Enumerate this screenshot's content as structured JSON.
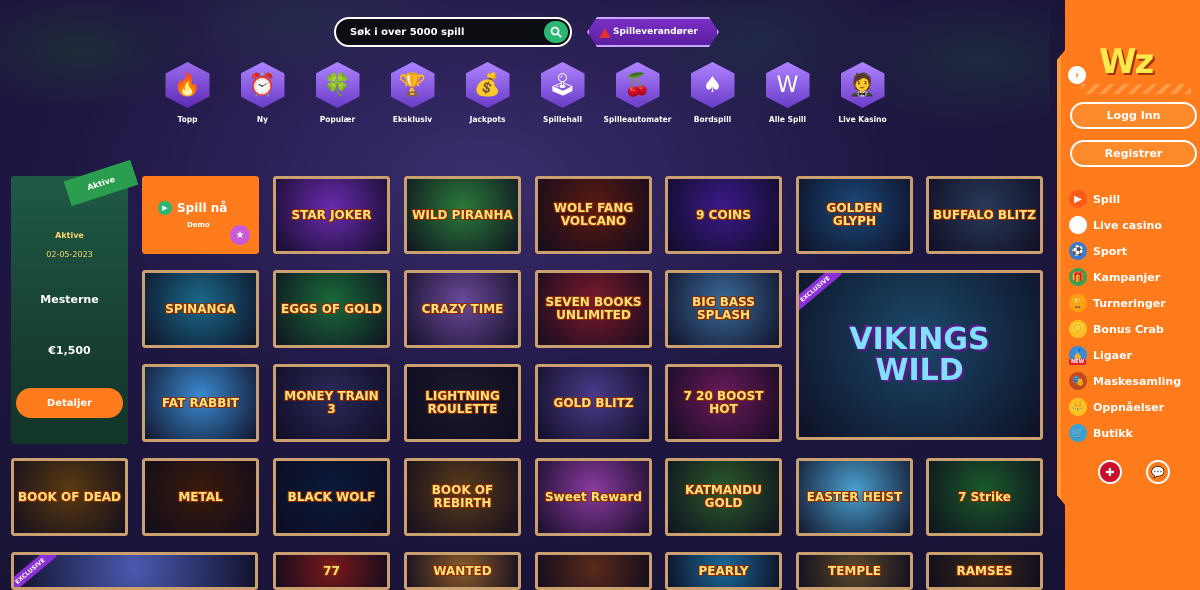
{
  "search": {
    "placeholder": "Søk i over 5000 spill"
  },
  "provider_button": {
    "label": "Spilleverandører"
  },
  "categories": [
    {
      "label": "Topp",
      "icon": "🔥"
    },
    {
      "label": "Ny",
      "icon": "⏰"
    },
    {
      "label": "Populær",
      "icon": "🍀"
    },
    {
      "label": "Eksklusiv",
      "icon": "🏆"
    },
    {
      "label": "Jackpots",
      "icon": "💰"
    },
    {
      "label": "Spillehall",
      "icon": "🕹"
    },
    {
      "label": "Spilleautomater",
      "icon": "🍒"
    },
    {
      "label": "Bordspill",
      "icon": "♠"
    },
    {
      "label": "Alle Spill",
      "icon": "W"
    },
    {
      "label": "Live Kasino",
      "icon": "🤵"
    }
  ],
  "promo": {
    "ribbon": "Aktive",
    "status": "Aktive",
    "date": "02-05-2023",
    "title": "Mesterne",
    "prize": "€1,500",
    "button": "Detaljer"
  },
  "play_now": {
    "label": "Spill nå",
    "sub": "Demo"
  },
  "games": [
    {
      "name": "STAR JOKER",
      "bg": "#6a2bb0"
    },
    {
      "name": "WILD PIRANHA",
      "bg": "#2a7a3a"
    },
    {
      "name": "WOLF FANG VOLCANO",
      "bg": "#5a1a10"
    },
    {
      "name": "9 COINS",
      "bg": "#3a1a8a"
    },
    {
      "name": "GOLDEN GLYPH",
      "bg": "#1a4a7a"
    },
    {
      "name": "BUFFALO BLITZ",
      "bg": "#2a3a5a"
    },
    {
      "name": "SPINANGA",
      "bg": "#1a6a8a"
    },
    {
      "name": "EGGS OF GOLD",
      "bg": "#1a6a3a"
    },
    {
      "name": "CRAZY TIME",
      "bg": "#6a4a9a"
    },
    {
      "name": "SEVEN BOOKS UNLIMITED",
      "bg": "#7a1a2a"
    },
    {
      "name": "BIG BASS SPLASH",
      "bg": "#3a6a9a"
    },
    {
      "name": "VIKINGS WILD",
      "bg": "#1a4a6a",
      "exclusive": "EXCLUSIVE"
    },
    {
      "name": "FAT RABBIT",
      "bg": "#3a8ad0"
    },
    {
      "name": "MONEY TRAIN 3",
      "bg": "#2a2a5a"
    },
    {
      "name": "LIGHTNING ROULETTE",
      "bg": "#1a1a2a"
    },
    {
      "name": "GOLD BLITZ",
      "bg": "#4a3a8a"
    },
    {
      "name": "7 20 BOOST HOT",
      "bg": "#6a1a5a"
    },
    {
      "name": "BOOK OF DEAD",
      "bg": "#5a3a10"
    },
    {
      "name": "METAL",
      "bg": "#3a1a0a"
    },
    {
      "name": "BLACK WOLF",
      "bg": "#0a1a3a"
    },
    {
      "name": "BOOK OF REBIRTH",
      "bg": "#5a3a1a"
    },
    {
      "name": "Sweet Reward",
      "bg": "#8a3aa0"
    },
    {
      "name": "KATMANDU GOLD",
      "bg": "#2a5a2a"
    },
    {
      "name": "EASTER HEIST",
      "bg": "#4aa0d0"
    },
    {
      "name": "7 Strike",
      "bg": "#1a5a2a"
    },
    {
      "name": "",
      "bg": "#4a5ab0",
      "exclusive": "EXCLUSIVE"
    },
    {
      "name": "77",
      "bg": "#7a1a1a"
    },
    {
      "name": "WANTED",
      "bg": "#8a5a2a"
    },
    {
      "name": "",
      "bg": "#5a2a1a"
    },
    {
      "name": "PEARLY",
      "bg": "#1a6a9a"
    },
    {
      "name": "TEMPLE",
      "bg": "#5a4a2a"
    },
    {
      "name": "RAMSES",
      "bg": "#3a2a1a"
    }
  ],
  "sidebar": {
    "logo": "Wz",
    "login": "Logg Inn",
    "register": "Registrer",
    "menu": [
      {
        "label": "Spill",
        "icon": "▶",
        "color": "#ff5a1c"
      },
      {
        "label": "Live casino",
        "icon": "●",
        "color": "#ffffff"
      },
      {
        "label": "Sport",
        "icon": "⚽",
        "color": "#3a7ad0"
      },
      {
        "label": "Kampanjer",
        "icon": "🎁",
        "color": "#3aa050"
      },
      {
        "label": "Turneringer",
        "icon": "🏆",
        "color": "#ffa010"
      },
      {
        "label": "Bonus Crab",
        "icon": "🪙",
        "color": "#ffc020"
      },
      {
        "label": "Ligaer",
        "icon": "🏅",
        "color": "#3a8ad0",
        "badge": "NEW"
      },
      {
        "label": "Maskesamling",
        "icon": "🎭",
        "color": "#c04a20"
      },
      {
        "label": "Oppnåelser",
        "icon": "👑",
        "color": "#ffc020"
      },
      {
        "label": "Butikk",
        "icon": "🛒",
        "color": "#3aa0d0"
      }
    ]
  }
}
